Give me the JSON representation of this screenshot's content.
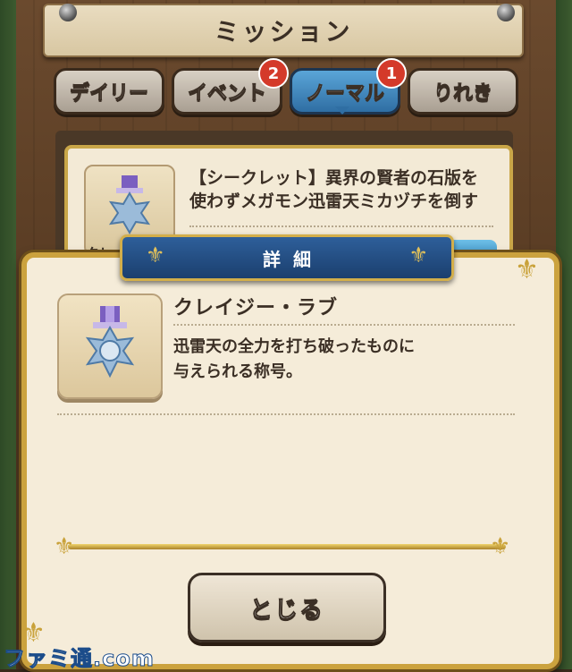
{
  "header": {
    "title": "ミッション"
  },
  "tabs": [
    {
      "label": "デイリー",
      "badge": ""
    },
    {
      "label": "イベント",
      "badge": "2"
    },
    {
      "label": "ノーマル",
      "badge": "1"
    },
    {
      "label": "りれき",
      "badge": ""
    }
  ],
  "mission_card": {
    "line1": "【シークレット】異界の賢者の石版を",
    "line2": "使わずメガモン迅雷天ミカヅチを倒す",
    "partial_label": "クレイジ"
  },
  "detail": {
    "header_title": "詳細",
    "item_name": "クレイジー・ラブ",
    "desc_line1": "迅雷天の全力を打ち破ったものに",
    "desc_line2": "与えられる称号。",
    "close_label": "とじる"
  },
  "watermark": "ファミ通.com",
  "colors": {
    "accent_blue": "#2f6ea3",
    "gold": "#cba23e",
    "badge_red": "#d43a2a",
    "panel_bg": "#f5ecd9"
  },
  "icons": {
    "medal": "medal-icon",
    "fleur": "fleur-de-lis-icon"
  }
}
